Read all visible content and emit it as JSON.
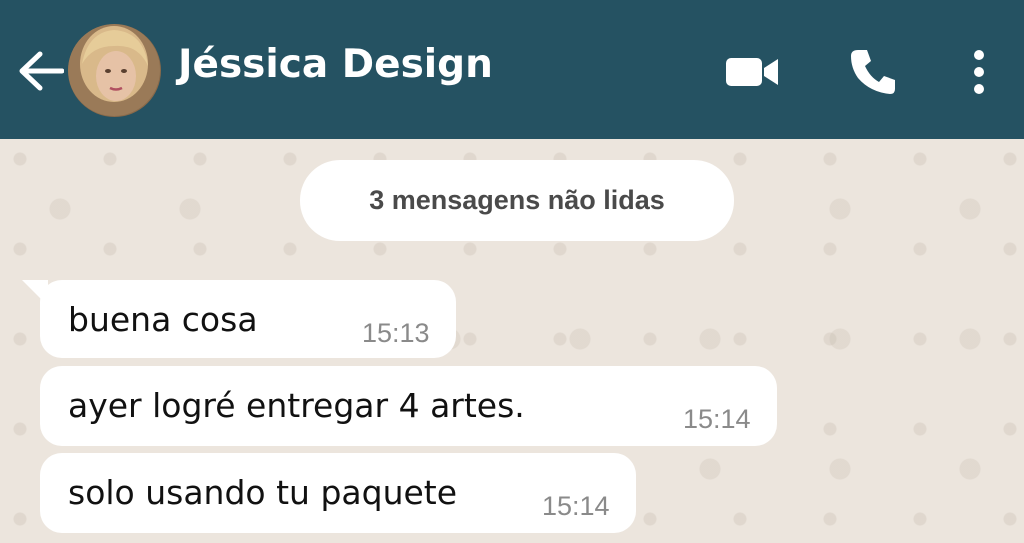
{
  "header": {
    "contact_name": "Jéssica Design",
    "back_icon": "arrow-back-icon",
    "video_icon": "video-call-icon",
    "call_icon": "phone-icon",
    "menu_icon": "more-vert-icon",
    "background_color": "#255262"
  },
  "chat": {
    "unread_label": "3 mensagens não lidas",
    "messages": [
      {
        "text": "buena cosa",
        "time": "15:13"
      },
      {
        "text": "ayer logré entregar 4 artes.",
        "time": "15:14"
      },
      {
        "text": "solo usando tu paquete",
        "time": "15:14"
      }
    ],
    "background_color": "#ece5dd",
    "bubble_color": "#ffffff"
  }
}
